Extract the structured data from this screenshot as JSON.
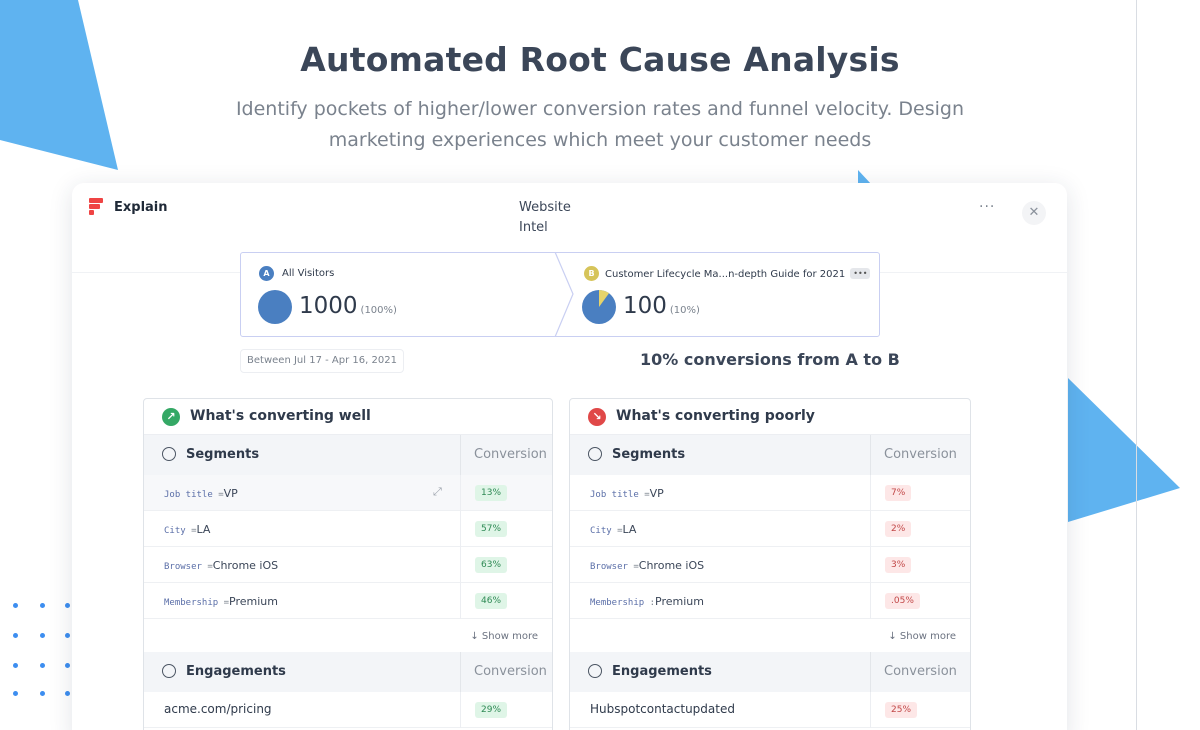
{
  "hero": {
    "title": "Automated Root Cause Analysis",
    "subtitle_line1": "Identify pockets of higher/lower conversion rates and funnel velocity. Design",
    "subtitle_line2": "marketing experiences which meet your customer needs"
  },
  "colors": {
    "accent_blue": "#4a7fc1",
    "decor_blue": "#5fb3f0",
    "good_green": "#2f8a55",
    "bad_red": "#c24848",
    "logo_red": "#ef4444"
  },
  "app": {
    "name": "Explain",
    "title_line1": "Website",
    "title_line2": "Intel",
    "more_label": "···",
    "close_label": "✕"
  },
  "funnel": {
    "step_a": {
      "badge": "A",
      "label": "All Visitors",
      "count": "1000",
      "pct": "(100%)",
      "share": 1.0
    },
    "step_b": {
      "badge": "B",
      "label": "Customer Lifecycle Ma...n-depth Guide for 2021",
      "chip": "•••",
      "count": "100",
      "pct": "(10%)",
      "share": 0.1
    },
    "date_range": "Between Jul 17 - Apr 16, 2021",
    "summary": "10% conversions from A to B"
  },
  "panels": {
    "well": {
      "title": "What's converting well",
      "icon": "↗",
      "segments_label": "Segments",
      "conversion_label": "Conversion",
      "segments": [
        {
          "key": "Job title",
          "eq": "=",
          "value": "VP",
          "conv": "13%"
        },
        {
          "key": "City",
          "eq": "=",
          "value": "LA",
          "conv": "57%"
        },
        {
          "key": "Browser",
          "eq": "=",
          "value": "Chrome iOS",
          "conv": "63%"
        },
        {
          "key": "Membership",
          "eq": "=",
          "value": "Premium",
          "conv": "46%"
        }
      ],
      "show_more": "↓ Show more",
      "engagements_label": "Engagements",
      "engagements": [
        {
          "value": "acme.com/pricing",
          "conv": "29%"
        }
      ]
    },
    "poorly": {
      "title": "What's converting poorly",
      "icon": "↘",
      "segments_label": "Segments",
      "conversion_label": "Conversion",
      "segments": [
        {
          "key": "Job title",
          "eq": "=",
          "value": "VP",
          "conv": "7%"
        },
        {
          "key": "City",
          "eq": "=",
          "value": "LA",
          "conv": "2%"
        },
        {
          "key": "Browser",
          "eq": "=",
          "value": "Chrome iOS",
          "conv": "3%"
        },
        {
          "key": "Membership",
          "eq": ":",
          "value": "Premium",
          "conv": ".05%"
        }
      ],
      "show_more": "↓ Show more",
      "engagements_label": "Engagements",
      "engagements": [
        {
          "value": "Hubspotcontactupdated",
          "conv": "25%"
        }
      ]
    }
  }
}
